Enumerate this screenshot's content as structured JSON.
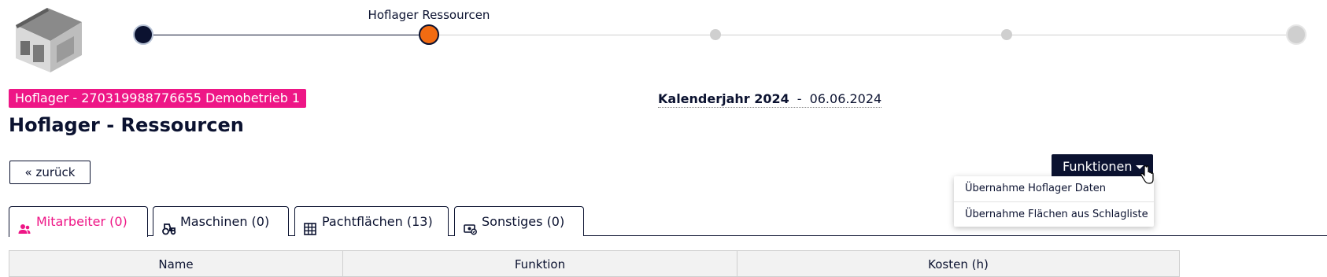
{
  "stepper": {
    "active_label": "Hoflager Ressourcen",
    "steps": 5,
    "current_step": 2
  },
  "badge": "Hoflager - 270319988776655 Demobetrieb 1",
  "calendar": {
    "label": "Kalenderjahr 2024",
    "separator": "-",
    "date": "06.06.2024"
  },
  "page_title": "Hoflager - Ressourcen",
  "back_button": "«  zurück",
  "functions": {
    "button_label": "Funktionen",
    "menu_items": [
      "Übernahme Hoflager Daten",
      "Übernahme Flächen aus Schlagliste"
    ]
  },
  "tabs": [
    {
      "label": "Mitarbeiter (0)",
      "icon": "users-icon",
      "active": true
    },
    {
      "label": "Maschinen (0)",
      "icon": "tractor-icon",
      "active": false
    },
    {
      "label": "Pachtflächen (13)",
      "icon": "grid-icon",
      "active": false
    },
    {
      "label": "Sonstiges (0)",
      "icon": "money-icon",
      "active": false
    }
  ],
  "table": {
    "columns": [
      "Name",
      "Funktion",
      "Kosten (h)"
    ]
  },
  "colors": {
    "brand_pink": "#ee1686",
    "navy": "#0b1230",
    "active_step": "#f26b12",
    "inactive_step": "#cfcfcf"
  }
}
